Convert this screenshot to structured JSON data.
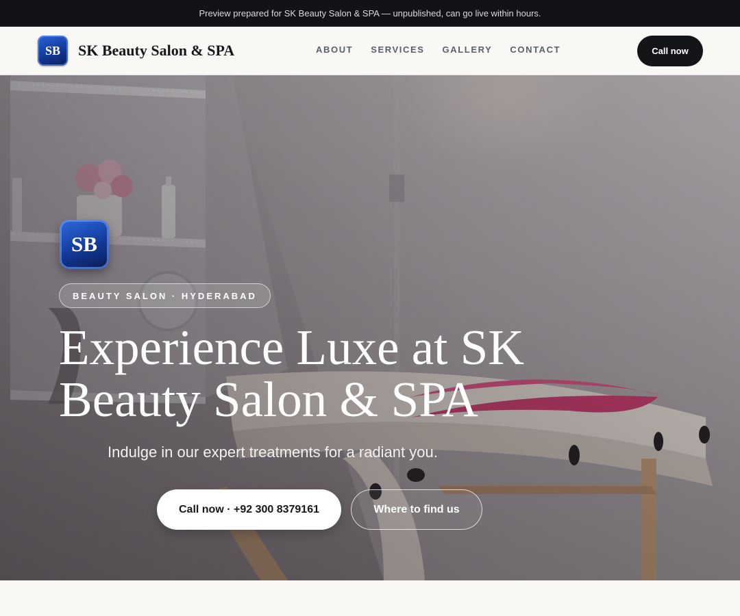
{
  "preview_bar": {
    "text": "Preview prepared for SK Beauty Salon & SPA — unpublished, can go live within hours."
  },
  "header": {
    "logo_initials": "SB",
    "brand_name": "SK Beauty Salon & SPA",
    "nav": [
      {
        "label": "ABOUT"
      },
      {
        "label": "SERVICES"
      },
      {
        "label": "GALLERY"
      },
      {
        "label": "CONTACT"
      }
    ],
    "cta_label": "Call now"
  },
  "hero": {
    "logo_initials": "SB",
    "badge": "BEAUTY SALON · HYDERABAD",
    "title": "Experience Luxe at SK Beauty Salon & SPA",
    "subtitle": "Indulge in our expert treatments for a radiant you.",
    "primary_button": "Call now · +92 300 8379161",
    "secondary_button": "Where to find us"
  },
  "colors": {
    "dark": "#111318",
    "page_bg": "#f9f8f5",
    "logo_blue": "#123a9a",
    "pillow_pink": "#d2396f"
  },
  "icons": {
    "hero_image": "spa-treatment-room-photo"
  }
}
